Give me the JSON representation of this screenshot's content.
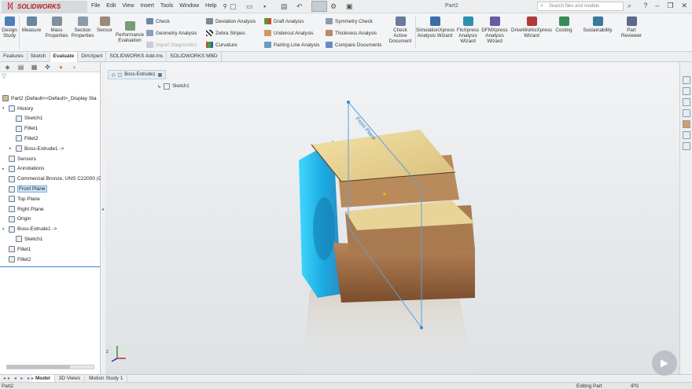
{
  "titlebar": {
    "app_name": "SOLIDWORKS",
    "menus": [
      "File",
      "Edit",
      "View",
      "Insert",
      "Tools",
      "Window",
      "Help"
    ],
    "doc_title": "Part2",
    "search_placeholder": "Search files and models"
  },
  "ribbon": {
    "big_buttons": [
      {
        "label": "Design Study",
        "icon": "design-study-icon",
        "color": "#4a7fb8"
      },
      {
        "label": "Measure",
        "icon": "measure-icon",
        "color": "#6b86a0"
      },
      {
        "label": "Mass Properties",
        "icon": "mass-properties-icon",
        "color": "#7f8fa0"
      },
      {
        "label": "Section Properties",
        "icon": "section-properties-icon",
        "color": "#8a9aac"
      },
      {
        "label": "Sensor",
        "icon": "sensor-icon",
        "color": "#9a8a7a"
      },
      {
        "label": "Performance Evaluation",
        "icon": "performance-icon",
        "color": "#7a9a7a"
      }
    ],
    "col1": [
      {
        "label": "Check",
        "disabled": false
      },
      {
        "label": "Geometry Analysis",
        "disabled": false
      },
      {
        "label": "Import Diagnostics",
        "disabled": true
      }
    ],
    "col2": [
      {
        "label": "Deviation Analysis",
        "disabled": false
      },
      {
        "label": "Zebra Stripes",
        "disabled": false
      },
      {
        "label": "Curvature",
        "disabled": false
      }
    ],
    "col3": [
      {
        "label": "Draft Analysis",
        "disabled": false
      },
      {
        "label": "Undercut Analysis",
        "disabled": false
      },
      {
        "label": "Parting Line Analysis",
        "disabled": false
      }
    ],
    "col4": [
      {
        "label": "Symmetry Check",
        "disabled": false
      },
      {
        "label": "Thickness Analysis",
        "disabled": false
      },
      {
        "label": "Compare Documents",
        "disabled": false
      }
    ],
    "check_active": "Check Active Document",
    "wizards": [
      {
        "label": "SimulationXpress Analysis Wizard",
        "color": "#3a6ea5"
      },
      {
        "label": "FloXpress Analysis Wizard",
        "color": "#2f8fb0"
      },
      {
        "label": "DFMXpress Analysis Wizard",
        "color": "#6a5aa0"
      },
      {
        "label": "DriveWorksXpress Wizard",
        "color": "#b03a3a"
      },
      {
        "label": "Costing",
        "color": "#3a8a5a"
      },
      {
        "label": "Sustainability",
        "color": "#3a7a9a"
      },
      {
        "label": "Part Reviewer",
        "color": "#5a6a8a"
      }
    ]
  },
  "command_tabs": [
    {
      "label": "Features",
      "active": false
    },
    {
      "label": "Sketch",
      "active": false
    },
    {
      "label": "Evaluate",
      "active": true
    },
    {
      "label": "DimXpert",
      "active": false
    },
    {
      "label": "SOLIDWORKS Add-Ins",
      "active": false
    },
    {
      "label": "SOLIDWORKS MBD",
      "active": false
    }
  ],
  "tree": {
    "root": "Part2  (Default<<Default>_Display Sta",
    "items": [
      {
        "label": "History",
        "indent": 1,
        "arrow": "▾",
        "selected": false
      },
      {
        "label": "Sketch1",
        "indent": 2,
        "arrow": "",
        "selected": false
      },
      {
        "label": "Fillet1",
        "indent": 2,
        "arrow": "",
        "selected": false
      },
      {
        "label": "Fillet2",
        "indent": 2,
        "arrow": "",
        "selected": false
      },
      {
        "label": "Boss-Extrude1 ->",
        "indent": 2,
        "arrow": "▸",
        "selected": false
      },
      {
        "label": "Sensors",
        "indent": 1,
        "arrow": "",
        "selected": false
      },
      {
        "label": "Annotations",
        "indent": 1,
        "arrow": "▸",
        "selected": false
      },
      {
        "label": "Commercial Bronze, UNS C22000 (C",
        "indent": 1,
        "arrow": "",
        "selected": false
      },
      {
        "label": "Front Plane",
        "indent": 1,
        "arrow": "",
        "selected": true
      },
      {
        "label": "Top Plane",
        "indent": 1,
        "arrow": "",
        "selected": false
      },
      {
        "label": "Right Plane",
        "indent": 1,
        "arrow": "",
        "selected": false
      },
      {
        "label": "Origin",
        "indent": 1,
        "arrow": "",
        "selected": false
      },
      {
        "label": "Boss-Extrude1 ->",
        "indent": 1,
        "arrow": "▾",
        "selected": false
      },
      {
        "label": "Sketch1",
        "indent": 2,
        "arrow": "",
        "selected": false
      },
      {
        "label": "Fillet1",
        "indent": 1,
        "arrow": "",
        "selected": false
      },
      {
        "label": "Fillet2",
        "indent": 1,
        "arrow": "",
        "selected": false
      }
    ]
  },
  "viewport": {
    "breadcrumb": "Boss-Extrude1",
    "breadcrumb_child": "Sketch1",
    "plane_label": "Front Plane"
  },
  "bottom_tabs": [
    {
      "label": "Model",
      "active": true
    },
    {
      "label": "3D Views",
      "active": false
    },
    {
      "label": "Motion Study 1",
      "active": false
    }
  ],
  "status": {
    "left": "Part2",
    "mode": "Editing Part",
    "units": "IPS"
  }
}
